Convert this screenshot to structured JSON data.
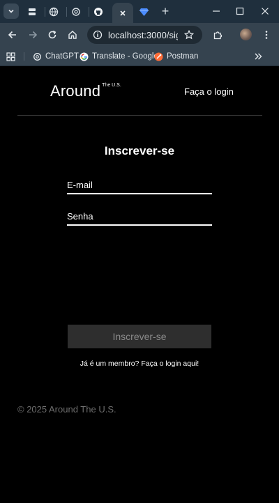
{
  "browser": {
    "url": "localhost:3000/sig...",
    "tabs": [
      {
        "icon": "tab-icon-1"
      },
      {
        "icon": "globe-icon"
      },
      {
        "icon": "chatgpt-icon"
      },
      {
        "icon": "github-icon"
      },
      {
        "icon": "close-icon",
        "active": true
      },
      {
        "icon": "gem-icon"
      }
    ],
    "bookmarks": [
      {
        "label": "ChatGPT",
        "icon": "chatgpt-icon"
      },
      {
        "label": "Translate - Google",
        "icon": "google-icon"
      },
      {
        "label": "Postman",
        "icon": "postman-icon"
      }
    ],
    "colors": {
      "tabbar": "#1f2f3d",
      "toolbar": "#35434f"
    }
  },
  "header": {
    "logo_main": "Around",
    "logo_sup": "The U.S.",
    "login_link": "Faça o login"
  },
  "form": {
    "title": "Inscrever-se",
    "email_placeholder": "E-mail",
    "password_placeholder": "Senha",
    "submit_label": "Inscrever-se",
    "member_link": "Já é um membro? Faça o login aqui!"
  },
  "footer": {
    "copyright": "© 2025 Around The U.S."
  }
}
